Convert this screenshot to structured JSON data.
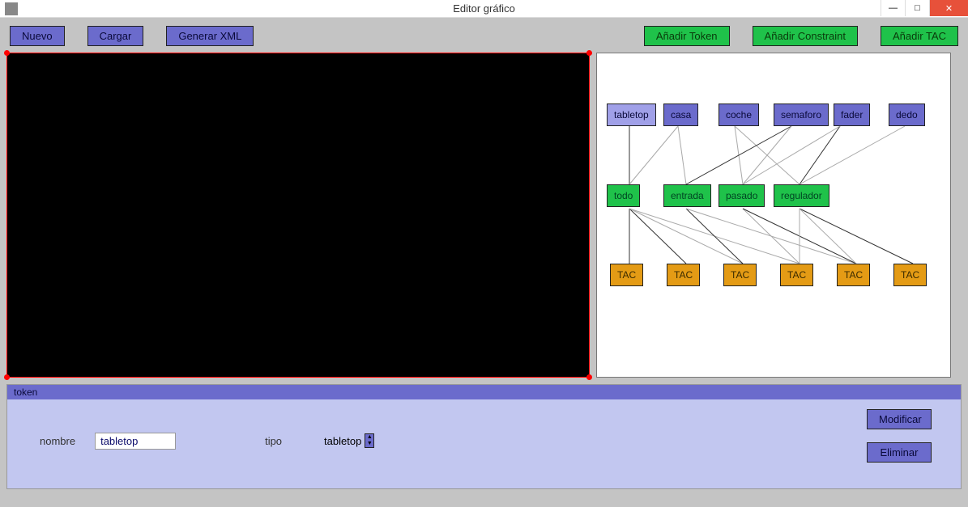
{
  "window": {
    "title": "Editor gráfico"
  },
  "toolbar": {
    "nuevo": "Nuevo",
    "cargar": "Cargar",
    "generar": "Generar XML",
    "add_token": "Añadir Token",
    "add_constraint": "Añadir Constraint",
    "add_tac": "Añadir TAC"
  },
  "graph": {
    "tokens": [
      {
        "label": "tabletop",
        "selected": true
      },
      {
        "label": "casa"
      },
      {
        "label": "coche"
      },
      {
        "label": "semaforo"
      },
      {
        "label": "fader"
      },
      {
        "label": "dedo"
      }
    ],
    "constraints": [
      {
        "label": "todo"
      },
      {
        "label": "entrada"
      },
      {
        "label": "pasado"
      },
      {
        "label": "regulador"
      }
    ],
    "tacs": [
      {
        "label": "TAC"
      },
      {
        "label": "TAC"
      },
      {
        "label": "TAC"
      },
      {
        "label": "TAC"
      },
      {
        "label": "TAC"
      },
      {
        "label": "TAC"
      }
    ]
  },
  "panel": {
    "header": "token",
    "nombre_label": "nombre",
    "nombre_value": "tabletop",
    "tipo_label": "tipo",
    "tipo_value": "tabletop",
    "modificar": "Modificar",
    "eliminar": "Eliminar"
  }
}
